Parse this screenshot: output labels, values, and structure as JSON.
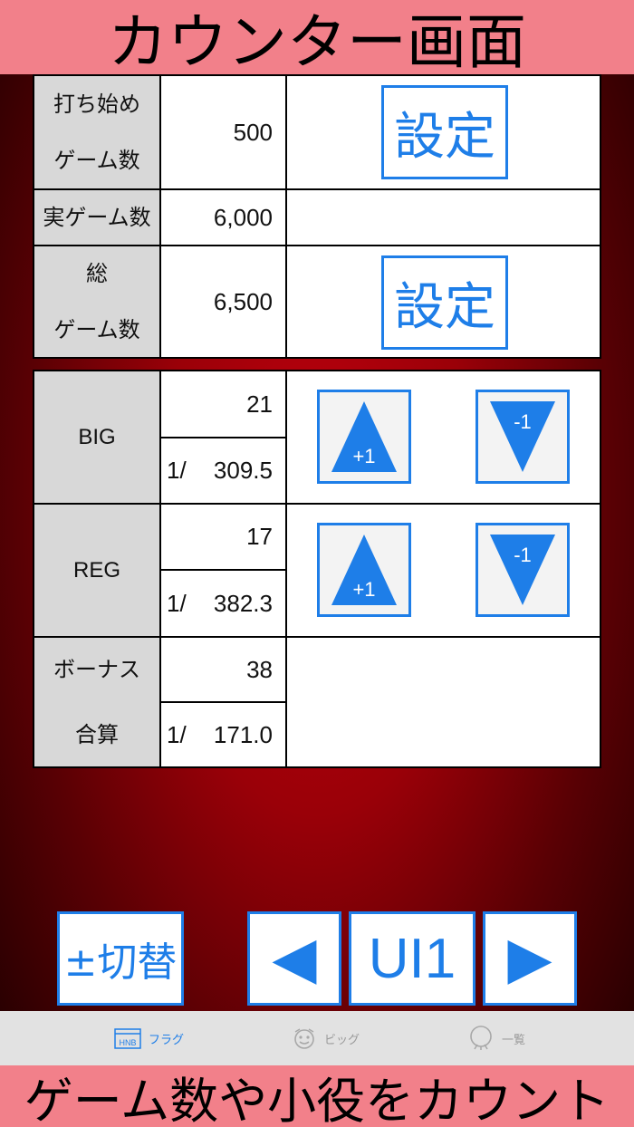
{
  "banner_top": "カウンター画面",
  "banner_bottom": "ゲーム数や小役をカウント",
  "games": {
    "start_label_1": "打ち始め",
    "start_label_2": "ゲーム数",
    "start_value": "500",
    "actual_label": "実ゲーム数",
    "actual_value": "6,000",
    "total_label_1": "総",
    "total_label_2": "ゲーム数",
    "total_value": "6,500",
    "set_label": "設定"
  },
  "counters": {
    "big": {
      "label": "BIG",
      "count": "21",
      "ratio_prefix": "1/",
      "ratio": "309.5"
    },
    "reg": {
      "label": "REG",
      "count": "17",
      "ratio_prefix": "1/",
      "ratio": "382.3"
    },
    "bonus": {
      "label_1": "ボーナス",
      "label_2": "合算",
      "count": "38",
      "ratio_prefix": "1/",
      "ratio": "171.0"
    },
    "plus_label": "+1",
    "minus_label": "-1"
  },
  "controls": {
    "switch_label": "±切替",
    "prev_symbol": "◀",
    "ui_label": "UI1",
    "next_symbol": "▶"
  },
  "tabs": {
    "flag": {
      "label": "フラグ",
      "icon_text": "HNB"
    },
    "big": {
      "label": "ビッグ"
    },
    "list": {
      "label": "一覧"
    }
  },
  "colors": {
    "accent": "#1e7ee8",
    "banner": "#f2808a",
    "label_bg": "#d8d8d8"
  }
}
